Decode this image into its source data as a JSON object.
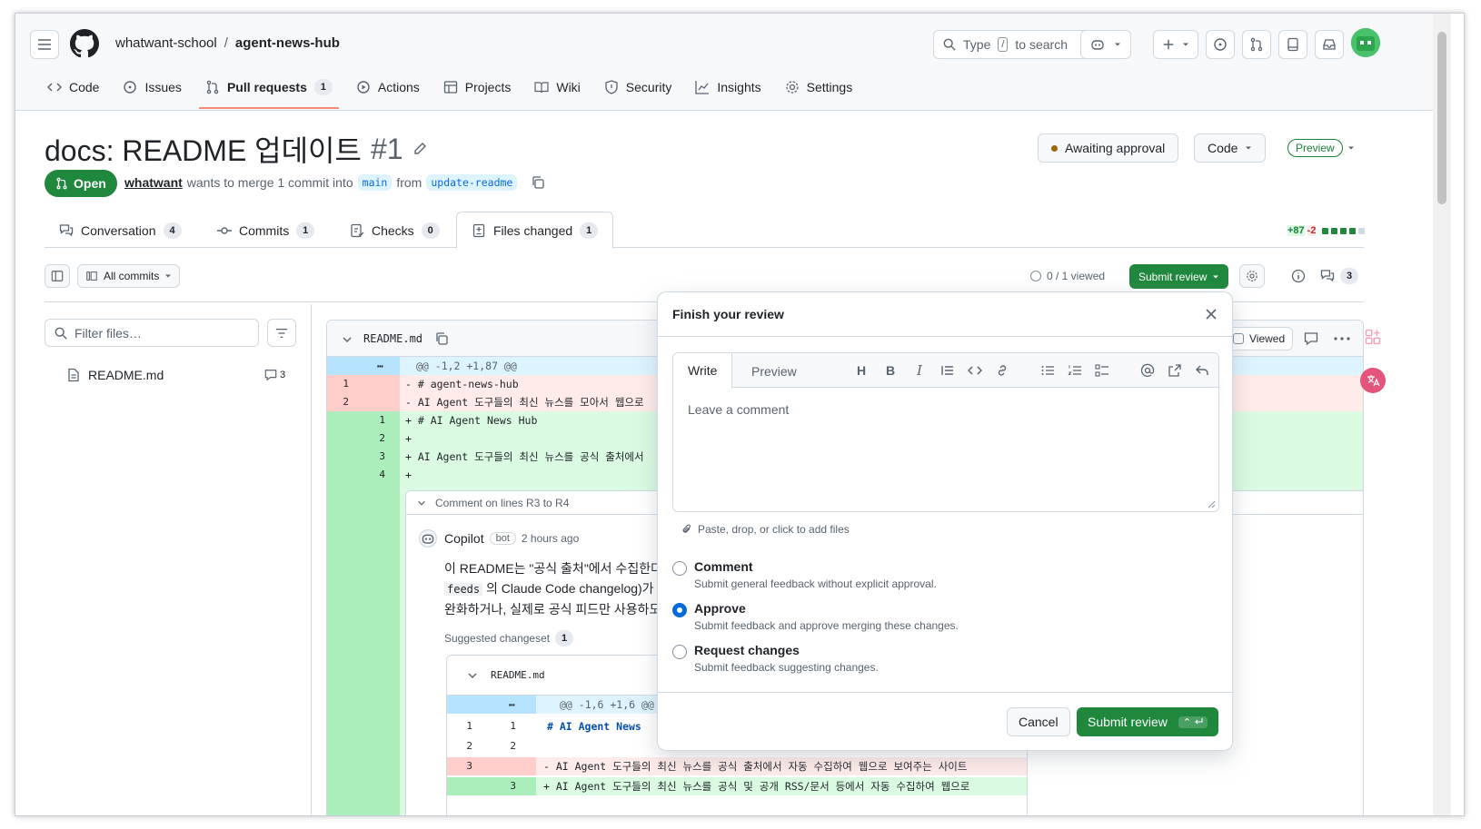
{
  "header": {
    "owner": "whatwant-school",
    "separator": "/",
    "repo": "agent-news-hub",
    "search_prefix": "Type",
    "search_key": "/",
    "search_suffix": "to search"
  },
  "nav": {
    "items": [
      {
        "label": "Code",
        "icon": "code-icon"
      },
      {
        "label": "Issues",
        "icon": "issue-icon"
      },
      {
        "label": "Pull requests",
        "icon": "pull-request-icon",
        "count": "1",
        "active": true
      },
      {
        "label": "Actions",
        "icon": "play-icon"
      },
      {
        "label": "Projects",
        "icon": "table-icon"
      },
      {
        "label": "Wiki",
        "icon": "book-icon"
      },
      {
        "label": "Security",
        "icon": "shield-icon"
      },
      {
        "label": "Insights",
        "icon": "graph-icon"
      },
      {
        "label": "Settings",
        "icon": "gear-icon"
      }
    ]
  },
  "pr": {
    "title": "docs: README 업데이트",
    "number": "#1",
    "state": "Open",
    "author": "whatwant",
    "merge_text": "wants to merge 1 commit into",
    "base": "main",
    "from_text": "from",
    "head": "update-readme",
    "awaiting": "Awaiting approval",
    "code_btn": "Code",
    "preview": "Preview"
  },
  "tabs": [
    {
      "label": "Conversation",
      "count": "4"
    },
    {
      "label": "Commits",
      "count": "1"
    },
    {
      "label": "Checks",
      "count": "0"
    },
    {
      "label": "Files changed",
      "count": "1",
      "active": true
    }
  ],
  "diffstat": {
    "add": "+87",
    "del": "-2"
  },
  "toolbar": {
    "all_commits": "All commits",
    "viewed": "0 / 1 viewed",
    "submit_review": "Submit review",
    "comments_count": "3"
  },
  "files": {
    "filter_placeholder": "Filter files…",
    "items": [
      {
        "name": "README.md",
        "comments": "3"
      }
    ]
  },
  "diff": {
    "filename": "README.md",
    "hunk": "@@ -1,2 +1,87 @@",
    "viewed_label": "Viewed",
    "lines": [
      {
        "type": "del",
        "old": "1",
        "new": "",
        "text": "- # agent-news-hub"
      },
      {
        "type": "del",
        "old": "2",
        "new": "",
        "text": "- AI Agent 도구들의 최신 뉴스를 모아서 웹으로"
      },
      {
        "type": "add",
        "old": "",
        "new": "1",
        "text": "+ # AI Agent News Hub"
      },
      {
        "type": "add",
        "old": "",
        "new": "2",
        "text": "+"
      },
      {
        "type": "add",
        "old": "",
        "new": "3",
        "text": "+ AI Agent 도구들의 최신 뉴스를 공식 출처에서"
      },
      {
        "type": "add",
        "old": "",
        "new": "4",
        "text": "+"
      }
    ],
    "thread": {
      "label": "Comment on lines R3 to R4",
      "author": "Copilot",
      "badge": "bot",
      "time": "2 hours ago",
      "body1": "이 README는 \"공식 출처\"에서 수집한다",
      "body2_code": "feeds",
      "body2": "의 Claude Code changelog)가",
      "body3": "완화하거나, 실제로 공식 피드만 사용하도",
      "suggested": "Suggested changeset",
      "suggested_count": "1",
      "inner_file": "README.md",
      "inner_hunk": "@@ -1,6 +1,6 @@",
      "inner_lines": [
        {
          "type": "ctx",
          "old": "1",
          "new": "1",
          "text": "  # AI Agent News"
        },
        {
          "type": "ctx",
          "old": "2",
          "new": "2",
          "text": ""
        },
        {
          "type": "del",
          "old": "3",
          "new": "",
          "text": "- AI Agent 도구들의 최신 뉴스를 공식 출처에서 자동 수집하여 웹으로 보여주는 사이트"
        },
        {
          "type": "add",
          "old": "",
          "new": "3",
          "text": "+ AI Agent 도구들의 최신 뉴스를 공식 및 공개 RSS/문서 등에서 자동 수집하여 웹으로"
        }
      ]
    }
  },
  "modal": {
    "title": "Finish your review",
    "write": "Write",
    "preview": "Preview",
    "placeholder": "Leave a comment",
    "attach": "Paste, drop, or click to add files",
    "options": [
      {
        "label": "Comment",
        "desc": "Submit general feedback without explicit approval.",
        "checked": false
      },
      {
        "label": "Approve",
        "desc": "Submit feedback and approve merging these changes.",
        "checked": true
      },
      {
        "label": "Request changes",
        "desc": "Submit feedback suggesting changes.",
        "checked": false
      }
    ],
    "cancel": "Cancel",
    "submit": "Submit review"
  },
  "colors": {
    "green": "#1f883d",
    "accent": "#0969da",
    "nav_underline": "#fd8c73"
  }
}
